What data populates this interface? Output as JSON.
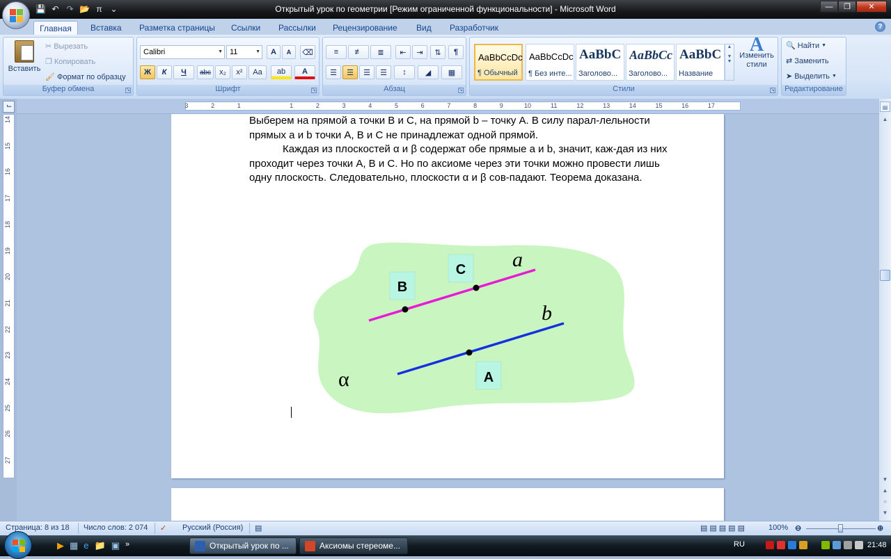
{
  "window": {
    "title": "Открытый урок по геометрии [Режим ограниченной функциональности] - Microsoft Word"
  },
  "ribbon": {
    "tabs": [
      "Главная",
      "Вставка",
      "Разметка страницы",
      "Ссылки",
      "Рассылки",
      "Рецензирование",
      "Вид",
      "Разработчик"
    ],
    "clipboard": {
      "paste": "Вставить",
      "cut": "Вырезать",
      "copy": "Копировать",
      "format_painter": "Формат по образцу",
      "label": "Буфер обмена"
    },
    "font": {
      "name": "Calibri",
      "size": "11",
      "label": "Шрифт",
      "bold": "Ж",
      "italic": "К",
      "underline": "Ч",
      "strike": "abc",
      "sub": "x₂",
      "sup": "x²",
      "case": "Aa",
      "grow": "A",
      "shrink": "A",
      "color": "A",
      "highlight": "ab"
    },
    "paragraph": {
      "label": "Абзац",
      "pilcrow": "¶"
    },
    "styles": {
      "label": "Стили",
      "items": [
        {
          "preview": "AaBbCcDc",
          "name": "¶ Обычный"
        },
        {
          "preview": "AaBbCcDc",
          "name": "¶ Без инте..."
        },
        {
          "preview": "AaBbC",
          "name": "Заголово..."
        },
        {
          "preview": "AaBbCc",
          "name": "Заголово..."
        },
        {
          "preview": "AaBbC",
          "name": "Название"
        }
      ],
      "change": "Изменить стили"
    },
    "editing": {
      "find": "Найти",
      "replace": "Заменить",
      "select": "Выделить",
      "label": "Редактирование"
    }
  },
  "ruler": {
    "h_ticks": [
      "3",
      "2",
      "1",
      "1",
      "2",
      "3",
      "4",
      "5",
      "6",
      "7",
      "8",
      "9",
      "10",
      "11",
      "12",
      "13",
      "14",
      "15",
      "16",
      "17"
    ],
    "v_ticks": [
      "14",
      "15",
      "16",
      "17",
      "18",
      "19",
      "20",
      "21",
      "22",
      "23",
      "24",
      "25",
      "26",
      "27"
    ]
  },
  "document": {
    "paragraph1": "Выберем на прямой a точки B и C, на прямой b – точку A. В силу парал-лельности прямых  a и b точки A, B и C не принадлежат одной прямой.",
    "paragraph2": "Каждая из плоскостей α и β содержат обе прямые a и b, значит, каж-дая из них проходит через точки A, B и C. Но по аксиоме через эти точки можно провести лишь одну плоскость. Следовательно, плоскости α и β сов-падают. Теорема доказана.",
    "figure": {
      "plane_label": "α",
      "line_a_label": "a",
      "line_b_label": "b",
      "point_b": "B",
      "point_c": "C",
      "point_a": "A",
      "plane_color": "#c8f5c0",
      "line_a_color": "#e81ad6",
      "line_b_color": "#1530e0",
      "label_box_color": "#b8f5e2"
    }
  },
  "statusbar": {
    "page": "Страница: 8 из 18",
    "words": "Число слов: 2 074",
    "language": "Русский (Россия)",
    "zoom": "100%"
  },
  "taskbar": {
    "tasks": [
      "Открытый урок по ...",
      "Аксиомы стереоме..."
    ],
    "lang": "RU",
    "time": "21:48"
  }
}
